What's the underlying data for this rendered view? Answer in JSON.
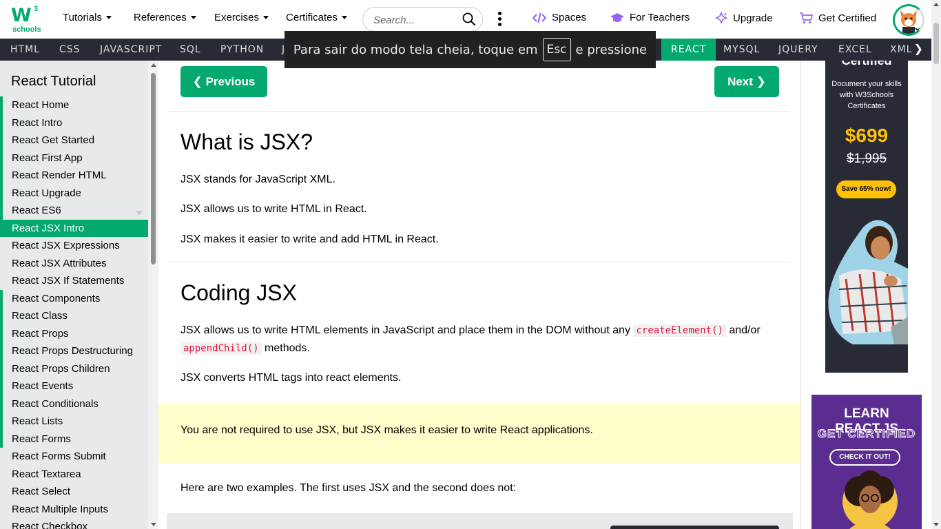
{
  "logo": {
    "text": "W",
    "superscript": "3",
    "subtitle": "schools"
  },
  "topnav": {
    "tutorials": "Tutorials",
    "references": "References",
    "exercises": "Exercises",
    "certificates": "Certificates",
    "search_placeholder": "Search...",
    "spaces": "Spaces",
    "for_teachers": "For Teachers",
    "upgrade": "Upgrade",
    "get_certified": "Get Certified"
  },
  "subnav": {
    "items": [
      "HTML",
      "CSS",
      "JAVASCRIPT",
      "SQL",
      "PYTHON",
      "J",
      "REACT",
      "MYSQL",
      "JQUERY",
      "EXCEL",
      "XML"
    ],
    "active": "REACT",
    "next_arrow": "❯"
  },
  "fullscreen_toast": {
    "before": "Para sair do modo tela cheia, toque em",
    "key": "Esc",
    "after": "e pressione"
  },
  "sidebar": {
    "title": "React Tutorial",
    "items": [
      "React Home",
      "React Intro",
      "React Get Started",
      "React First App",
      "React Render HTML",
      "React Upgrade",
      "React ES6",
      "React JSX Intro",
      "React JSX Expressions",
      "React JSX Attributes",
      "React JSX If Statements",
      "React Components",
      "React Class",
      "React Props",
      "React Props Destructuring",
      "React Props Children",
      "React Events",
      "React Conditionals",
      "React Lists",
      "React Forms",
      "React Forms Submit",
      "React Textarea",
      "React Select",
      "React Multiple Inputs",
      "React Checkbox"
    ],
    "active_index": 7
  },
  "main": {
    "prev_button": "❮ Previous",
    "next_button": "Next ❯",
    "section1": {
      "heading": "What is JSX?",
      "p1": "JSX stands for JavaScript XML.",
      "p2": "JSX allows us to write HTML in React.",
      "p3": "JSX makes it easier to write and add HTML in React."
    },
    "section2": {
      "heading": "Coding JSX",
      "p1_start": "JSX allows us to write HTML elements in JavaScript and place them in the DOM without any",
      "code1": "createElement()",
      "p1_mid": "and/or",
      "code2": "appendChild()",
      "p1_end": "methods.",
      "p2": "JSX converts HTML tags into react elements."
    },
    "note": "You are not required to use JSX, but JSX makes it easier to write React applications.",
    "examples_intro": "Here are two examples. The first uses JSX and the second does not:"
  },
  "ads": {
    "cert": {
      "cut_title": "Certified",
      "desc": "Document your skills with W3Schools Certificates",
      "price": "$699",
      "old_price": "$1,995",
      "save": "Save 65% now!"
    },
    "react": {
      "title": "LEARN REACT.JS",
      "subtitle": "GET CERTIFIED",
      "cta": "CHECK IT OUT!"
    }
  },
  "colors": {
    "accent": "#04aa6d",
    "dark": "#282a35",
    "note_bg": "#ffffcc",
    "code": "#dc143c",
    "ad_purple": "#5c2d91",
    "gold": "#ffc107"
  }
}
